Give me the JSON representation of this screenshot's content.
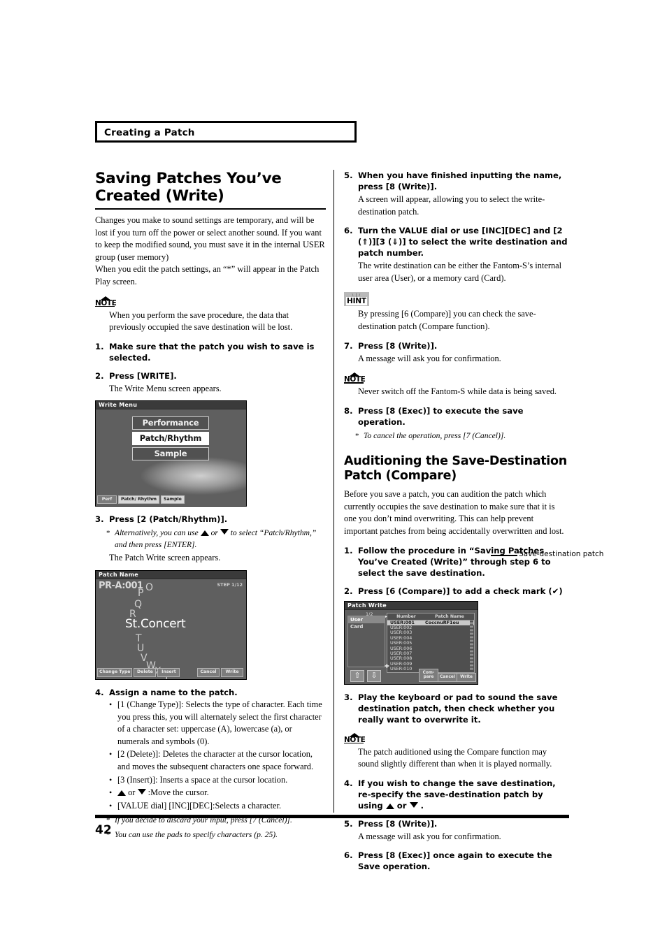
{
  "header": {
    "chapter": "Creating a Patch"
  },
  "footer": {
    "page_number": "42"
  },
  "left": {
    "title": "Saving Patches You’ve Created (Write)",
    "intro1": "Changes you make to sound settings are temporary, and will be lost if you turn off the power or select another sound. If you want to keep the modified sound, you must save it in the internal USER group (user memory)",
    "intro2": "When you edit the patch settings, an “*” will appear in the Patch Play screen.",
    "note1_label": "NOTE",
    "note1": "When you perform the save procedure, the data that previously occupied the save destination will be lost.",
    "step1_num": "1.",
    "step1": "Make sure that the patch you wish to save is selected.",
    "step2_num": "2.",
    "step2": "Press [WRITE].",
    "step2_sub": "The Write Menu screen appears.",
    "step3_num": "3.",
    "step3": "Press [2 (Patch/Rhythm)].",
    "step3_ast_a": "Alternatively, you can use",
    "step3_ast_or": "or",
    "step3_ast_b": "to select “Patch/Rhythm,” and then press [ENTER].",
    "step3_sub": "The Patch Write screen appears.",
    "step4_num": "4.",
    "step4": "Assign a name to the patch.",
    "bullets": [
      "[1 (Change Type)]: Selects the type of character. Each time you press this, you will alternately select the first character of a character set: uppercase (A), lowercase (a), or numerals and symbols (0).",
      "[2 (Delete)]: Deletes the character at the cursor location, and moves the subsequent characters one space forward.",
      "[3 (Insert)]: Inserts a space at the cursor location."
    ],
    "bullet_cursor_or": "or",
    "bullet_cursor_tail": ":Move the cursor.",
    "bullet_value": "[VALUE dial] [INC][DEC]:Selects a character.",
    "ast1": "If you decide to discard your input, press [7 (Cancel)].",
    "ast2": "You can use the pads to specify characters (p. 25)."
  },
  "right": {
    "step5_num": "5.",
    "step5": "When you have finished inputting the name, press [8 (Write)].",
    "step5_sub": "A screen will appear, allowing you to select the write-destination patch.",
    "step6_num": "6.",
    "step6": "Turn the VALUE dial or use [INC][DEC] and [2 (⇑)][3 (⇓)] to select the write destination and patch number.",
    "step6_sub": "The write destination can be either the Fantom-S’s internal user area (User), or a memory card (Card).",
    "hint_label": "HINT",
    "hint": "By pressing [6 (Compare)] you can check the save-destination patch (Compare function).",
    "step7_num": "7.",
    "step7": "Press [8 (Write)].",
    "step7_sub": "A message will ask you for confirmation.",
    "note2_label": "NOTE",
    "note2": "Never switch off the Fantom-S while data is being saved.",
    "step8_num": "8.",
    "step8": "Press [8 (Exec)] to execute the save operation.",
    "step8_ast": "To cancel the operation, press [7 (Cancel)].",
    "title2": "Auditioning the Save-Destination Patch (Compare)",
    "intro3": "Before you save a patch, you can audition the patch which currently occupies the save destination to make sure that it is one you don’t mind overwriting. This can help prevent important patches from being accidentally overwritten and lost.",
    "c_step1_num": "1.",
    "c_step1": "Follow the procedure in “Saving Patches You’ve Created (Write)” through step 6 to select the save destination.",
    "c_step2_num": "2.",
    "c_step2": "Press [6 (Compare)] to add a check mark (✔)",
    "callout": "Save-destination patch",
    "c_step3_num": "3.",
    "c_step3": "Play the keyboard or pad to sound the save destination patch, then check whether you really want to overwrite it.",
    "note3_label": "NOTE",
    "note3": "The patch auditioned using the Compare function may sound slightly different than when it is played normally.",
    "c_step4_num": "4.",
    "c_step4_a": "If you wish to change the save destination, re-specify the save-destination patch by using",
    "c_step4_or": "or",
    "c_step4_b": ".",
    "c_step5_num": "5.",
    "c_step5": "Press [8 (Write)].",
    "c_step5_sub": "A message will ask you for confirmation.",
    "c_step6_num": "6.",
    "c_step6": "Press [8 (Exec)] once again to execute the Save operation."
  },
  "screens": {
    "write_menu": {
      "title": "Write Menu",
      "items": [
        "Performance",
        "Patch/Rhythm",
        "Sample"
      ],
      "selected_index": 1,
      "tabs": [
        "Perf",
        "Patch/ Rhythm",
        "Sample"
      ],
      "lit_tab_index": 2
    },
    "patch_name": {
      "title": "Patch Name",
      "number": "PR-A:001",
      "step_label": "STEP 1/12",
      "value": "St.Concert",
      "chars": [
        "O",
        "P",
        "Q",
        "R",
        "T",
        "U",
        "V",
        "W",
        "X",
        "Y"
      ],
      "buttons_left": [
        "Change Type",
        "Delete",
        "Insert"
      ],
      "buttons_right": [
        "Cancel",
        "Write"
      ]
    },
    "patch_write": {
      "title": "Patch Write",
      "page": "1/2",
      "sources": [
        "User",
        "Card"
      ],
      "selected_source": 0,
      "columns": [
        "Number",
        "Patch Name"
      ],
      "rows": [
        {
          "number": "USER:001",
          "name": "CoccnuRF1ou"
        },
        {
          "number": "USER:002",
          "name": ""
        },
        {
          "number": "USER:003",
          "name": ""
        },
        {
          "number": "USER:004",
          "name": ""
        },
        {
          "number": "USER:005",
          "name": ""
        },
        {
          "number": "USER:006",
          "name": ""
        },
        {
          "number": "USER:007",
          "name": ""
        },
        {
          "number": "USER:008",
          "name": ""
        },
        {
          "number": "USER:009",
          "name": ""
        },
        {
          "number": "USER:010",
          "name": ""
        }
      ],
      "selected_row": 0,
      "buttons": [
        "Com- pare",
        "Cancel",
        "Write"
      ]
    }
  }
}
